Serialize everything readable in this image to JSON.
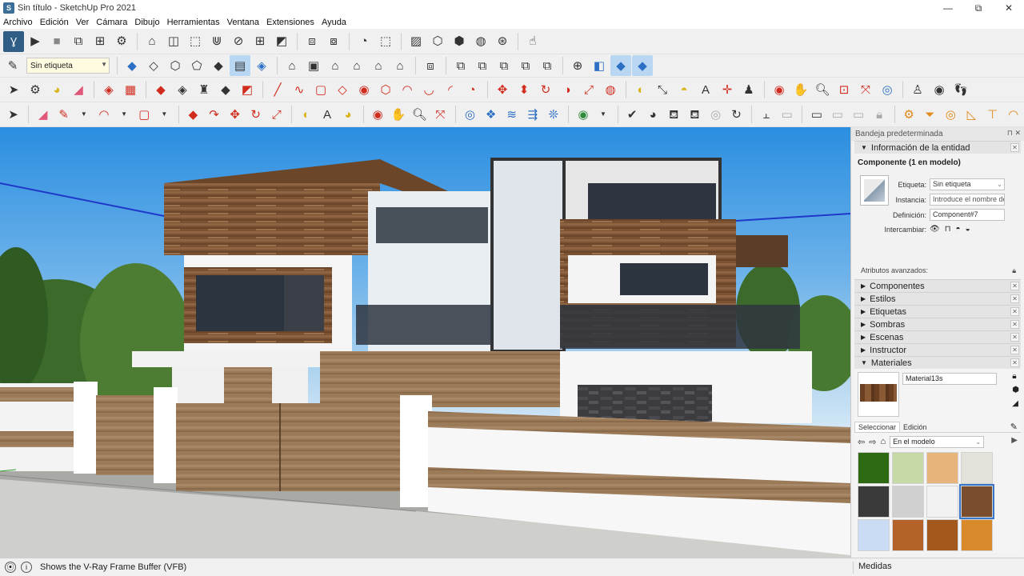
{
  "window": {
    "title": "Sin título - SketchUp Pro 2021",
    "controls": [
      "—",
      "⧉",
      "✕"
    ]
  },
  "menu": [
    "Archivo",
    "Edición",
    "Ver",
    "Cámara",
    "Dibujo",
    "Herramientas",
    "Ventana",
    "Extensiones",
    "Ayuda"
  ],
  "toolbar": {
    "tag_value": "Sin etiqueta"
  },
  "tray": {
    "header": "Bandeja predeterminada",
    "entity_info": {
      "title": "Información de la entidad",
      "component_label": "Componente (1 en modelo)",
      "tag_label": "Etiqueta:",
      "tag_value": "Sin etiqueta",
      "instance_label": "Instancia:",
      "instance_placeholder": "Introduce el nombre de",
      "definition_label": "Definición:",
      "definition_value": "Component#7",
      "swap_label": "Intercambiar:",
      "advanced_label": "Atributos avanzados:"
    },
    "panels": [
      "Componentes",
      "Estilos",
      "Etiquetas",
      "Sombras",
      "Escenas",
      "Instructor",
      "Materiales"
    ],
    "materials": {
      "name": "Material13s",
      "tab_select": "Seleccionar",
      "tab_edit": "Edición",
      "library": "En el modelo",
      "swatch_colors": [
        "#2e6a14",
        "#c8d9a8",
        "#e7b57c",
        "#e3e2da",
        "#3a3a3a",
        "#d0d0d0",
        "#f2f2f2",
        "#7a4e2c",
        "#c9dcf3",
        "#b5612a",
        "#a3581e",
        "#d88a2a"
      ]
    }
  },
  "status": {
    "message": "Shows the V-Ray Frame Buffer (VFB)",
    "measure_label": "Medidas"
  }
}
